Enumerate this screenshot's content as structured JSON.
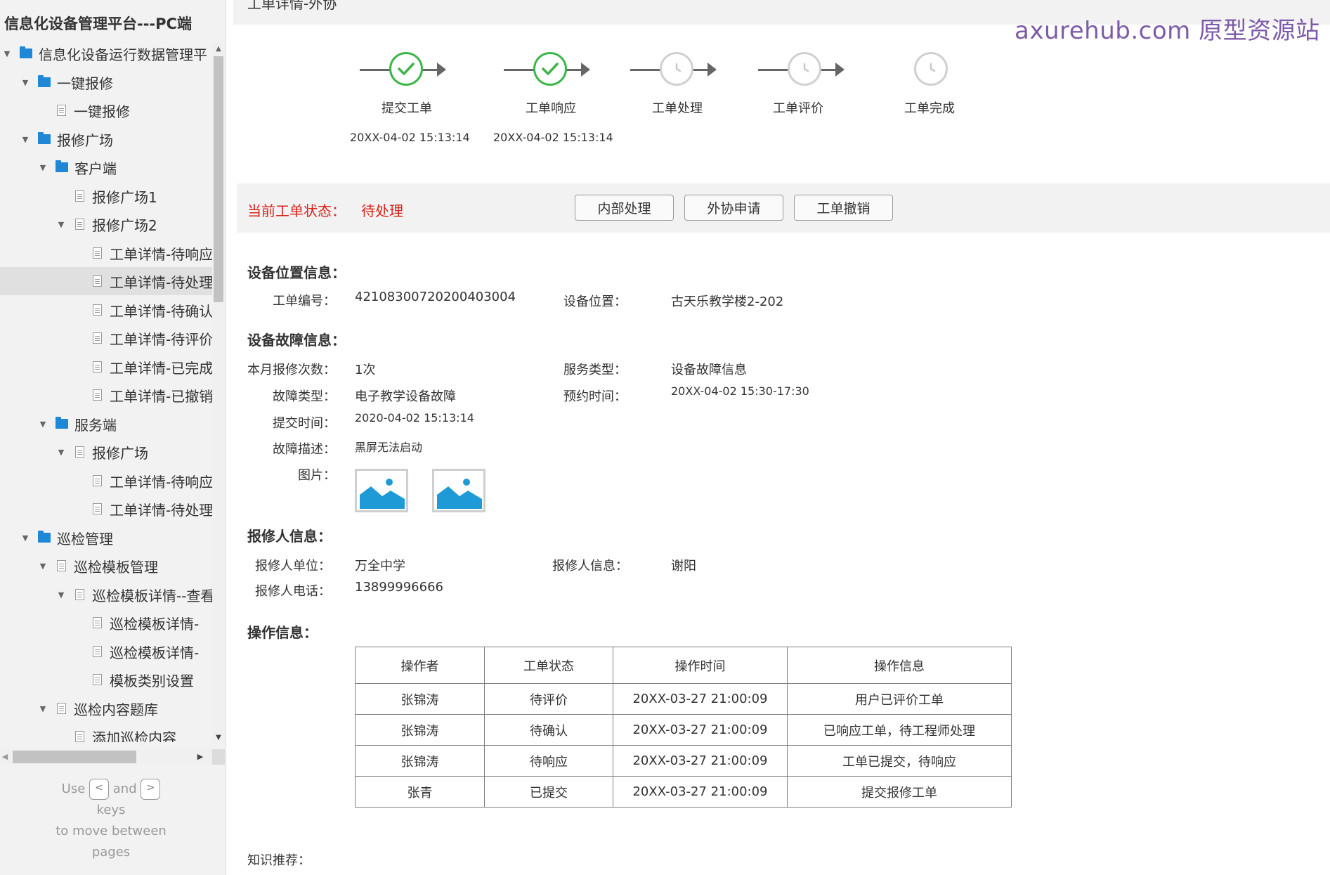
{
  "app": {
    "title": "信息化设备管理平台---PC端"
  },
  "sidebar": {
    "items": [
      {
        "label": "信息化设备运行数据管理平",
        "type": "folder",
        "level": 0,
        "expanded": true
      },
      {
        "label": "一键报修",
        "type": "folder",
        "level": 1,
        "expanded": true
      },
      {
        "label": "一键报修",
        "type": "page",
        "level": 2,
        "expanded": null
      },
      {
        "label": "报修广场",
        "type": "folder",
        "level": 1,
        "expanded": true
      },
      {
        "label": "客户端",
        "type": "folder",
        "level": 2,
        "expanded": true
      },
      {
        "label": "报修广场1",
        "type": "page",
        "level": 3,
        "expanded": null
      },
      {
        "label": "报修广场2",
        "type": "page",
        "level": 3,
        "expanded": true
      },
      {
        "label": "工单详情-待响应",
        "type": "page",
        "level": 4,
        "expanded": null
      },
      {
        "label": "工单详情-待处理",
        "type": "page",
        "level": 4,
        "expanded": null,
        "selected": true
      },
      {
        "label": "工单详情-待确认",
        "type": "page",
        "level": 4,
        "expanded": null
      },
      {
        "label": "工单详情-待评价",
        "type": "page",
        "level": 4,
        "expanded": null
      },
      {
        "label": "工单详情-已完成",
        "type": "page",
        "level": 4,
        "expanded": null
      },
      {
        "label": "工单详情-已撤销",
        "type": "page",
        "level": 4,
        "expanded": null
      },
      {
        "label": "服务端",
        "type": "folder",
        "level": 2,
        "expanded": true
      },
      {
        "label": "报修广场",
        "type": "page",
        "level": 3,
        "expanded": true
      },
      {
        "label": "工单详情-待响应",
        "type": "page",
        "level": 4,
        "expanded": null
      },
      {
        "label": "工单详情-待处理",
        "type": "page",
        "level": 4,
        "expanded": null
      },
      {
        "label": "巡检管理",
        "type": "folder",
        "level": 1,
        "expanded": true
      },
      {
        "label": "巡检模板管理",
        "type": "page",
        "level": 2,
        "expanded": true
      },
      {
        "label": "巡检模板详情--查看",
        "type": "page",
        "level": 3,
        "expanded": true
      },
      {
        "label": "巡检模板详情-",
        "type": "page",
        "level": 4,
        "expanded": null
      },
      {
        "label": "巡检模板详情-",
        "type": "page",
        "level": 4,
        "expanded": null
      },
      {
        "label": "模板类别设置",
        "type": "page",
        "level": 4,
        "expanded": null
      },
      {
        "label": "巡检内容题库",
        "type": "page",
        "level": 2,
        "expanded": true
      },
      {
        "label": "添加巡检内容",
        "type": "page",
        "level": 3,
        "expanded": null
      }
    ],
    "keys_hint": {
      "use": "Use",
      "and": "and",
      "keys": "keys",
      "move": "to move between",
      "pages": "pages",
      "prev_key": "<",
      "next_key": ">"
    }
  },
  "header": {
    "page_title": "工单详情-外协",
    "watermark": "axurehub.com 原型资源站"
  },
  "progress": {
    "steps": [
      {
        "label": "提交工单",
        "time": "20XX-04-02  15:13:14",
        "done": true
      },
      {
        "label": "工单响应",
        "time": "20XX-04-02  15:13:14",
        "done": true
      },
      {
        "label": "工单处理",
        "time": "",
        "done": false
      },
      {
        "label": "工单评价",
        "time": "",
        "done": false
      },
      {
        "label": "工单完成",
        "time": "",
        "done": false
      }
    ]
  },
  "status": {
    "label": "当前工单状态：",
    "value": "待处理",
    "buttons": {
      "internal": "内部处理",
      "outsource": "外协申请",
      "revoke": "工单撤销"
    }
  },
  "location": {
    "title": "设备位置信息：",
    "order_no_label": "工单编号：",
    "order_no": "42108300720200403004",
    "position_label": "设备位置：",
    "position": "古天乐教学楼2-202"
  },
  "fault": {
    "title": "设备故障信息：",
    "month_count_label": "本月报修次数：",
    "month_count": "1次",
    "service_type_label": "服务类型：",
    "service_type": "设备故障信息",
    "fault_type_label": "故障类型：",
    "fault_type": "电子教学设备故障",
    "appoint_label": "预约时间：",
    "appoint": "20XX-04-02  15:30-17:30",
    "submit_label": "提交时间：",
    "submit": "2020-04-02  15:13:14",
    "desc_label": "故障描述：",
    "desc": "黑屏无法启动",
    "pics_label": "图片："
  },
  "reporter": {
    "title": "报修人信息：",
    "unit_label": "报修人单位：",
    "unit": "万全中学",
    "info_label": "报修人信息：",
    "info": "谢阳",
    "phone_label": "报修人电话：",
    "phone": "13899996666"
  },
  "operations": {
    "title": "操作信息：",
    "headers": [
      "操作者",
      "工单状态",
      "操作时间",
      "操作信息"
    ],
    "rows": [
      [
        "张锦涛",
        "待评价",
        "20XX-03-27 21:00:09",
        "用户已评价工单"
      ],
      [
        "张锦涛",
        "待确认",
        "20XX-03-27 21:00:09",
        "已响应工单，待工程师处理"
      ],
      [
        "张锦涛",
        "待响应",
        "20XX-03-27 21:00:09",
        "工单已提交，待响应"
      ],
      [
        "张青",
        "已提交",
        "20XX-03-27 21:00:09",
        "提交报修工单"
      ]
    ]
  },
  "knowledge": {
    "title": "知识推荐："
  },
  "colors": {
    "accent_green": "#3cb64a",
    "status_red": "#d9231a",
    "folder_blue": "#1e88d6",
    "watermark": "#7d5ba8",
    "pending_gray": "#d0d0d0"
  }
}
